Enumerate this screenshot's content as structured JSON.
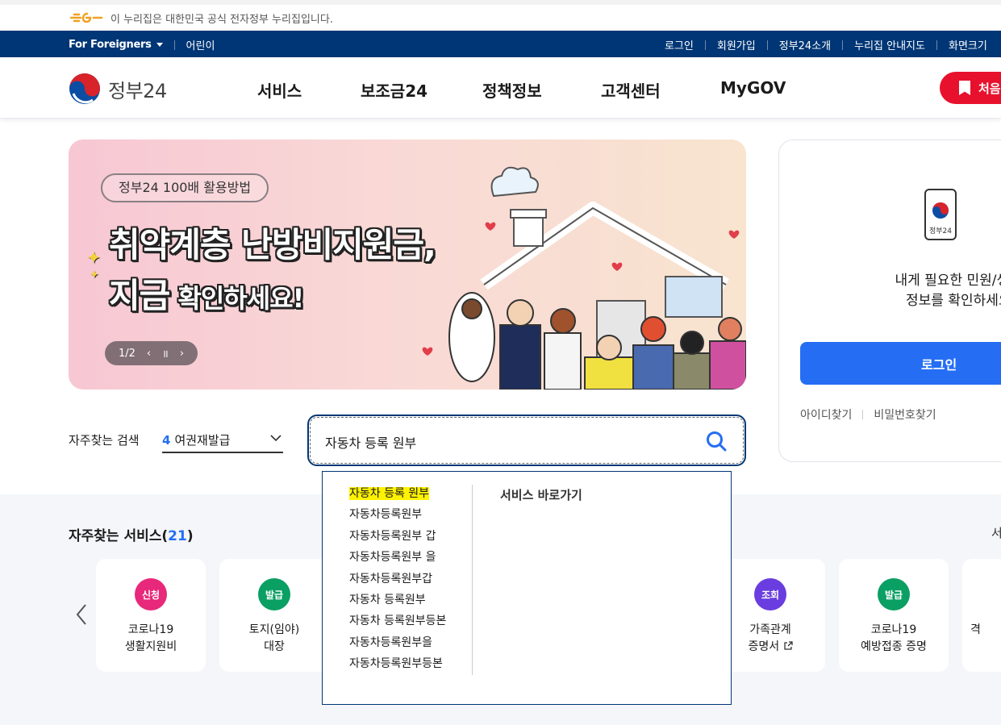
{
  "notice": {
    "text": "이 누리집은 대한민국 공식 전자정부 누리집입니다."
  },
  "topbar": {
    "left": [
      "For Foreigners",
      "어린이"
    ],
    "right": [
      "로그인",
      "회원가입",
      "정부24소개",
      "누리집 안내지도",
      "화면크기"
    ]
  },
  "header": {
    "logo_text": "정부24",
    "nav": [
      "서비스",
      "보조금24",
      "정책정보",
      "고객센터",
      "MyGOV"
    ],
    "start_button": "처음"
  },
  "banner": {
    "pill": "정부24 100배 활용방법",
    "line1": "취약계층 난방비지원금,",
    "line2a": "지금",
    "line2b": " 확인하세요!",
    "pager": "1/2"
  },
  "login": {
    "phone_label": "정부24",
    "message_line1": "내게 필요한 민원/생활/",
    "message_line2": "정보를 확인하세요.",
    "button": "로그인",
    "find_id": "아이디찾기",
    "find_pw": "비밀번호찾기"
  },
  "search": {
    "fav_label": "자주찾는 검색",
    "fav_num": "4",
    "fav_value": "여권재발급",
    "query": "자동차 등록 원부"
  },
  "autocomplete": {
    "items": [
      "자동차 등록 원부",
      "자동차등록원부",
      "자동차등록원부 갑",
      "자동차등록원부 을",
      "자동차등록원부갑",
      "자동차 등록원부",
      "자동차 등록원부등본",
      "자동차등록원부을",
      "자동차등록원부등본"
    ],
    "side_title": "서비스 바로가기"
  },
  "services": {
    "title": "자주찾는 서비스(",
    "count": "21",
    "title_end": ")",
    "more": "서",
    "cards": [
      {
        "badge": "신청",
        "color": "#e8287a",
        "line1": "코로나19",
        "line2": "생활지원비"
      },
      {
        "badge": "발급",
        "color": "#0a9f63",
        "line1": "토지(임야)",
        "line2": "대장"
      },
      {
        "badge": "조회",
        "color": "#6a3de0",
        "line1": "가족관계",
        "line2": "증명서"
      },
      {
        "badge": "발급",
        "color": "#0a9f63",
        "line1": "코로나19",
        "line2": "예방접종 증명"
      },
      {
        "badge": "",
        "color": "#ffffff",
        "line1": "격",
        "line2": ""
      }
    ]
  }
}
